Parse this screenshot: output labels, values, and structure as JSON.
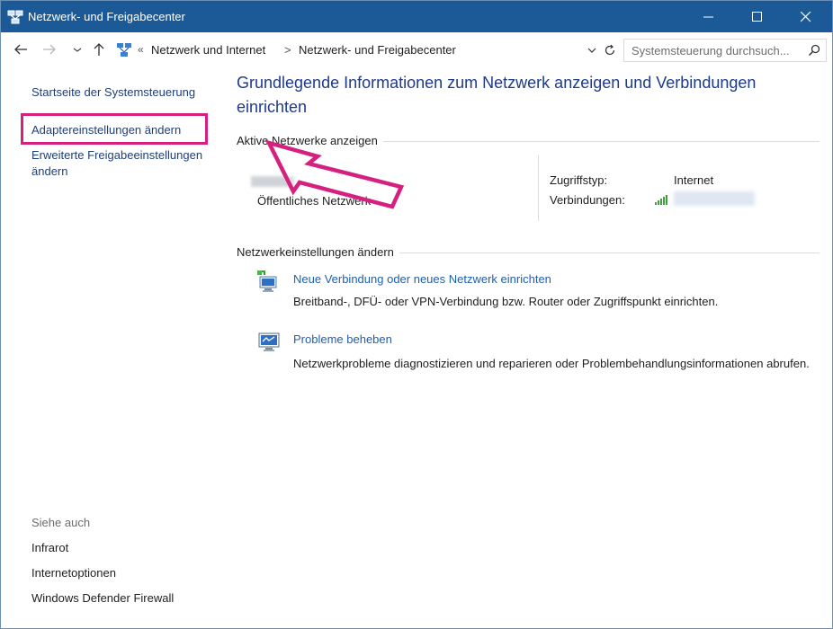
{
  "window": {
    "title": "Netzwerk- und Freigabecenter",
    "controls": [
      "minimize",
      "maximize",
      "close"
    ]
  },
  "addressbar": {
    "breadcrumb": [
      "Netzwerk und Internet",
      "Netzwerk- und Freigabecenter"
    ],
    "separator": ">",
    "search_placeholder": "Systemsteuerung durchsuch..."
  },
  "sidebar": {
    "home": "Startseite der Systemsteuerung",
    "adapter": "Adaptereinstellungen ändern",
    "sharing": "Erweiterte Freigabeeinstellungen ändern",
    "see_also_title": "Siehe auch",
    "see_also": [
      "Infrarot",
      "Internetoptionen",
      "Windows Defender Firewall"
    ]
  },
  "main": {
    "heading": "Grundlegende Informationen zum Netzwerk anzeigen und Verbindungen einrichten",
    "active_section": "Aktive Netzwerke anzeigen",
    "network_type": "Öffentliches Netzwerk",
    "access_type_label": "Zugriffstyp:",
    "access_type_value": "Internet",
    "connections_label": "Verbindungen:",
    "settings_section": "Netzwerkeinstellungen ändern",
    "tasks": [
      {
        "icon": "new-connection-icon",
        "link": "Neue Verbindung oder neues Netzwerk einrichten",
        "desc": "Breitband-, DFÜ- oder VPN-Verbindung bzw. Router oder Zugriffspunkt einrichten."
      },
      {
        "icon": "troubleshoot-icon",
        "link": "Probleme beheben",
        "desc": "Netzwerkprobleme diagnostizieren und reparieren oder Problembehandlungsinformationen abrufen."
      }
    ]
  },
  "colors": {
    "titlebar": "#1c5a97",
    "heading": "#1e3a8a",
    "link": "#1f5fb0",
    "annotation": "#d6207f"
  }
}
